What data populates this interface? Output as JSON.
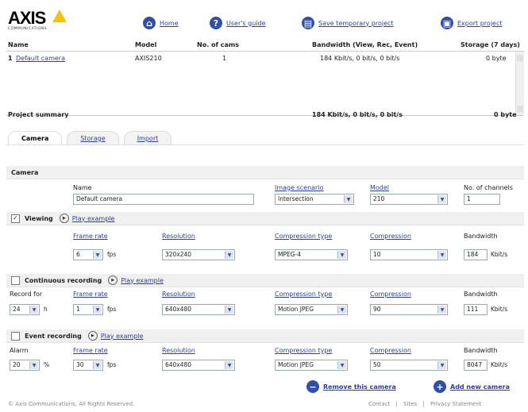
{
  "logo": {
    "text": "AXIS",
    "subtext": "COMMUNICATIONS"
  },
  "topnav": {
    "home": "Home",
    "users_guide": "User's guide",
    "save_project": "Save temporary project",
    "export_project": "Export project"
  },
  "table": {
    "headers": [
      "Name",
      "Model",
      "No. of cams",
      "Bandwidth (View, Rec, Event)",
      "Storage (7 days)"
    ],
    "rows": [
      {
        "index": "1",
        "name": "Default camera",
        "model": "AXIS210",
        "cams": "1",
        "bandwidth": "184 Kbit/s, 0 bit/s, 0 bit/s",
        "storage": "0 byte"
      }
    ],
    "summary": {
      "label": "Project summary",
      "bandwidth": "184 Kbit/s, 0 bit/s, 0 bit/s",
      "storage": "0 byte"
    }
  },
  "tabs": [
    "Camera",
    "Storage",
    "Import"
  ],
  "camera": {
    "section_title": "Camera",
    "name_label": "Name",
    "name_value": "Default camera",
    "scenario_label": "Image scenario",
    "scenario_value": "Intersection",
    "model_label": "Model",
    "model_value": "210",
    "channels_label": "No. of channels",
    "channels_value": "1"
  },
  "viewing": {
    "title": "Viewing",
    "checked": "✓",
    "play": "Play example",
    "frame_rate_label": "Frame rate",
    "frame_rate": "6",
    "fps": "fps",
    "resolution_label": "Resolution",
    "resolution": "320x240",
    "comp_type_label": "Compression type",
    "comp_type": "MPEG-4",
    "compression_label": "Compression",
    "compression": "10",
    "bandwidth_label": "Bandwidth",
    "bandwidth": "184",
    "bw_unit": "Kbit/s"
  },
  "continuous": {
    "title": "Continuous recording",
    "play": "Play example",
    "record_for_label": "Record for",
    "record_for": "24",
    "record_unit": "h",
    "frame_rate_label": "Frame rate",
    "frame_rate": "1",
    "fps": "fps",
    "resolution_label": "Resolution",
    "resolution": "640x480",
    "comp_type_label": "Compression type",
    "comp_type": "Motion JPEG",
    "compression_label": "Compression",
    "compression": "90",
    "bandwidth_label": "Bandwidth",
    "bandwidth": "111",
    "bw_unit": "Kbit/s"
  },
  "event": {
    "title": "Event recording",
    "play": "Play example",
    "alarm_label": "Alarm",
    "alarm": "20",
    "alarm_unit": "%",
    "frame_rate_label": "Frame rate",
    "frame_rate": "30",
    "fps": "fps",
    "resolution_label": "Resolution",
    "resolution": "640x480",
    "comp_type_label": "Compression type",
    "comp_type": "Motion JPEG",
    "compression_label": "Compression",
    "compression": "50",
    "bandwidth_label": "Bandwidth",
    "bandwidth": "8047",
    "bw_unit": "Kbit/s"
  },
  "actions": {
    "remove": "Remove this camera",
    "add": "Add new camera"
  },
  "footer": {
    "copyright": "© Axis Communications, All Rights Reserved.",
    "links": [
      "Contact",
      "Sites",
      "Privacy Statement"
    ],
    "separator": "|"
  },
  "icons": {
    "home": "home-icon",
    "guide": "help-icon",
    "save": "save-icon",
    "export": "export-icon",
    "remove": "minus-icon",
    "add": "plus-icon",
    "play": "play-icon"
  },
  "colors": {
    "link": "#2a3f9e",
    "icon": "#2f4fa8",
    "logo_accent": "#f5c400"
  }
}
